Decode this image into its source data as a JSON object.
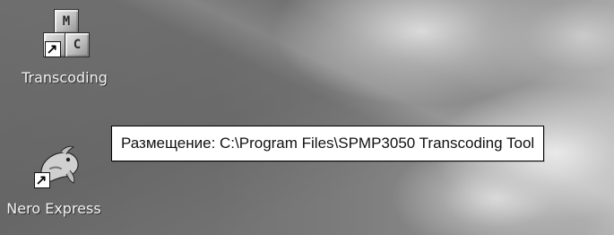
{
  "desktop": {
    "icons": [
      {
        "label": "Transcoding",
        "icon_name": "transcoding-blocks-icon",
        "blocks": [
          "M",
          "",
          "C"
        ],
        "shortcut": true
      },
      {
        "label": "Nero Express",
        "icon_name": "nero-express-icon",
        "shortcut": true
      }
    ]
  },
  "tooltip": {
    "text": "Размещение: C:\\Program Files\\SPMP3050 Transcoding Tool"
  }
}
